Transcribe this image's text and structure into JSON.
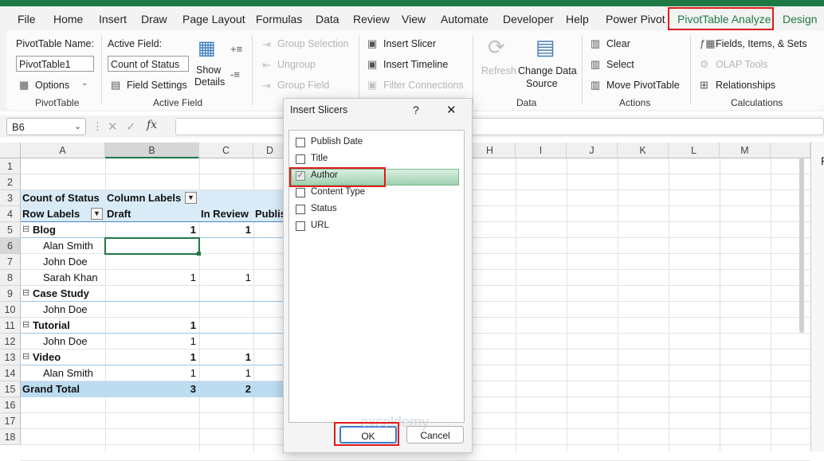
{
  "tabs": [
    "File",
    "Home",
    "Insert",
    "Draw",
    "Page Layout",
    "Formulas",
    "Data",
    "Review",
    "View",
    "Automate",
    "Developer",
    "Help",
    "Power Pivot",
    "PivotTable Analyze",
    "Design"
  ],
  "active_tab": "PivotTable Analyze",
  "accent_color": "#1e7a45",
  "ribbon": {
    "pivottable": {
      "name_label": "PivotTable Name:",
      "name_value": "PivotTable1",
      "options": "Options",
      "group": "PivotTable"
    },
    "active_field": {
      "label": "Active Field:",
      "value": "Count of Status",
      "field_settings": "Field Settings",
      "show_details_1": "Show",
      "show_details_2": "Details",
      "group": "Active Field"
    },
    "group": {
      "selection": "Group Selection",
      "ungroup": "Ungroup",
      "field": "Group Field"
    },
    "filter": {
      "slicer": "Insert Slicer",
      "timeline": "Insert Timeline",
      "connections": "Filter Connections"
    },
    "data": {
      "refresh": "Refresh",
      "change_1": "Change Data",
      "change_2": "Source",
      "group": "Data"
    },
    "actions": {
      "clear": "Clear",
      "select": "Select",
      "move": "Move PivotTable",
      "group": "Actions"
    },
    "calculations": {
      "fields": "Fields, Items, & Sets",
      "olap": "OLAP Tools",
      "relationships": "Relationships",
      "group": "Calculations"
    }
  },
  "formula_bar": {
    "name_box": "B6",
    "fx": "fx",
    "formula": ""
  },
  "columns": [
    "A",
    "B",
    "C",
    "D",
    "H",
    "I",
    "J",
    "K",
    "L",
    "M"
  ],
  "rows": [
    "1",
    "2",
    "3",
    "4",
    "5",
    "6",
    "7",
    "8",
    "9",
    "10",
    "11",
    "12",
    "13",
    "14",
    "15",
    "16",
    "17",
    "18"
  ],
  "pivot": {
    "count_label": "Count of Status",
    "col_labels": "Column Labels",
    "row_labels": "Row Labels",
    "draft": "Draft",
    "in_review": "In Review",
    "publish": "Publis",
    "rows": [
      {
        "label": "Blog",
        "bold": true,
        "b": "1",
        "c": "1"
      },
      {
        "label": "Alan Smith",
        "bold": false,
        "b": "",
        "c": ""
      },
      {
        "label": "John Doe",
        "bold": false,
        "b": "",
        "c": ""
      },
      {
        "label": "Sarah Khan",
        "bold": false,
        "b": "1",
        "c": "1"
      },
      {
        "label": "Case Study",
        "bold": true,
        "b": "",
        "c": ""
      },
      {
        "label": "John Doe",
        "bold": false,
        "b": "",
        "c": ""
      },
      {
        "label": "Tutorial",
        "bold": true,
        "b": "1",
        "c": ""
      },
      {
        "label": "John Doe",
        "bold": false,
        "b": "1",
        "c": ""
      },
      {
        "label": "Video",
        "bold": true,
        "b": "1",
        "c": "1"
      },
      {
        "label": "Alan Smith",
        "bold": false,
        "b": "1",
        "c": "1"
      },
      {
        "label": "Grand Total",
        "bold": true,
        "b": "3",
        "c": "2"
      }
    ]
  },
  "dialog": {
    "title": "Insert Slicers",
    "help": "?",
    "close": "✕",
    "fields": [
      {
        "label": "Publish Date",
        "checked": false
      },
      {
        "label": "Title",
        "checked": false
      },
      {
        "label": "Author",
        "checked": true
      },
      {
        "label": "Content Type",
        "checked": false
      },
      {
        "label": "Status",
        "checked": false
      },
      {
        "label": "URL",
        "checked": false
      }
    ],
    "ok": "OK",
    "cancel": "Cancel"
  },
  "watermark": "exceldemy",
  "taskpane_letter": "P"
}
